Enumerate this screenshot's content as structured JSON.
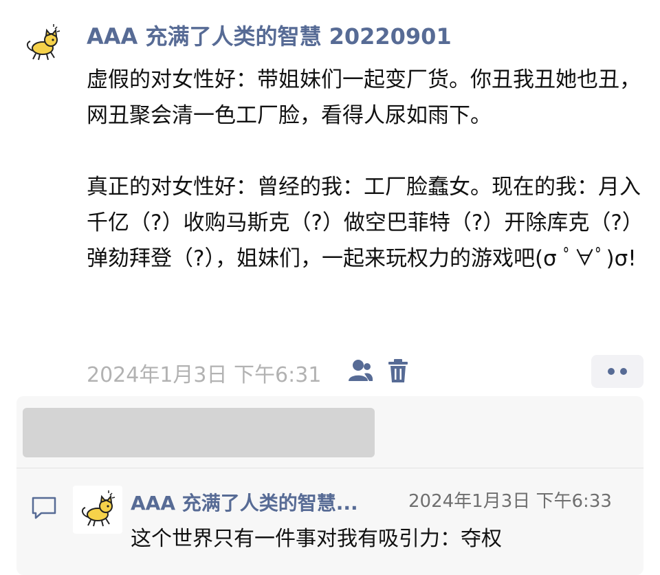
{
  "post": {
    "author": "AAA 充满了人类的智慧 20220901",
    "avatar_icon": "yellow-cat-icon",
    "content": "虚假的对女性好：带姐妹们一起变厂货。你丑我丑她也丑，网丑聚会清一色工厂脸，看得人尿如雨下。\n\n真正的对女性好：曾经的我：工厂脸蠢女。现在的我：月入千亿（?）收购马斯克（?）做空巴菲特（?）开除库克（?）弹劾拜登（?），姐妹们，一起来玩权力的游戏吧(σ ﾟ∀ﾟ)σ!",
    "timestamp": "2024年1月3日 下午6:31",
    "visibility_icon": "person-icon",
    "delete_icon": "trash-icon",
    "more_icon": "more-dots-icon"
  },
  "comments": [
    {
      "author": "AAA 充满了人类的智慧...",
      "timestamp": "2024年1月3日 下午6:33",
      "text": "这个世界只有一件事对我有吸引力：夺权",
      "avatar_icon": "yellow-cat-icon"
    }
  ],
  "colors": {
    "link": "#576b95",
    "muted": "#b2b2b2",
    "panel": "#f7f7f7",
    "avatar_yellow": "#f6d24a"
  }
}
